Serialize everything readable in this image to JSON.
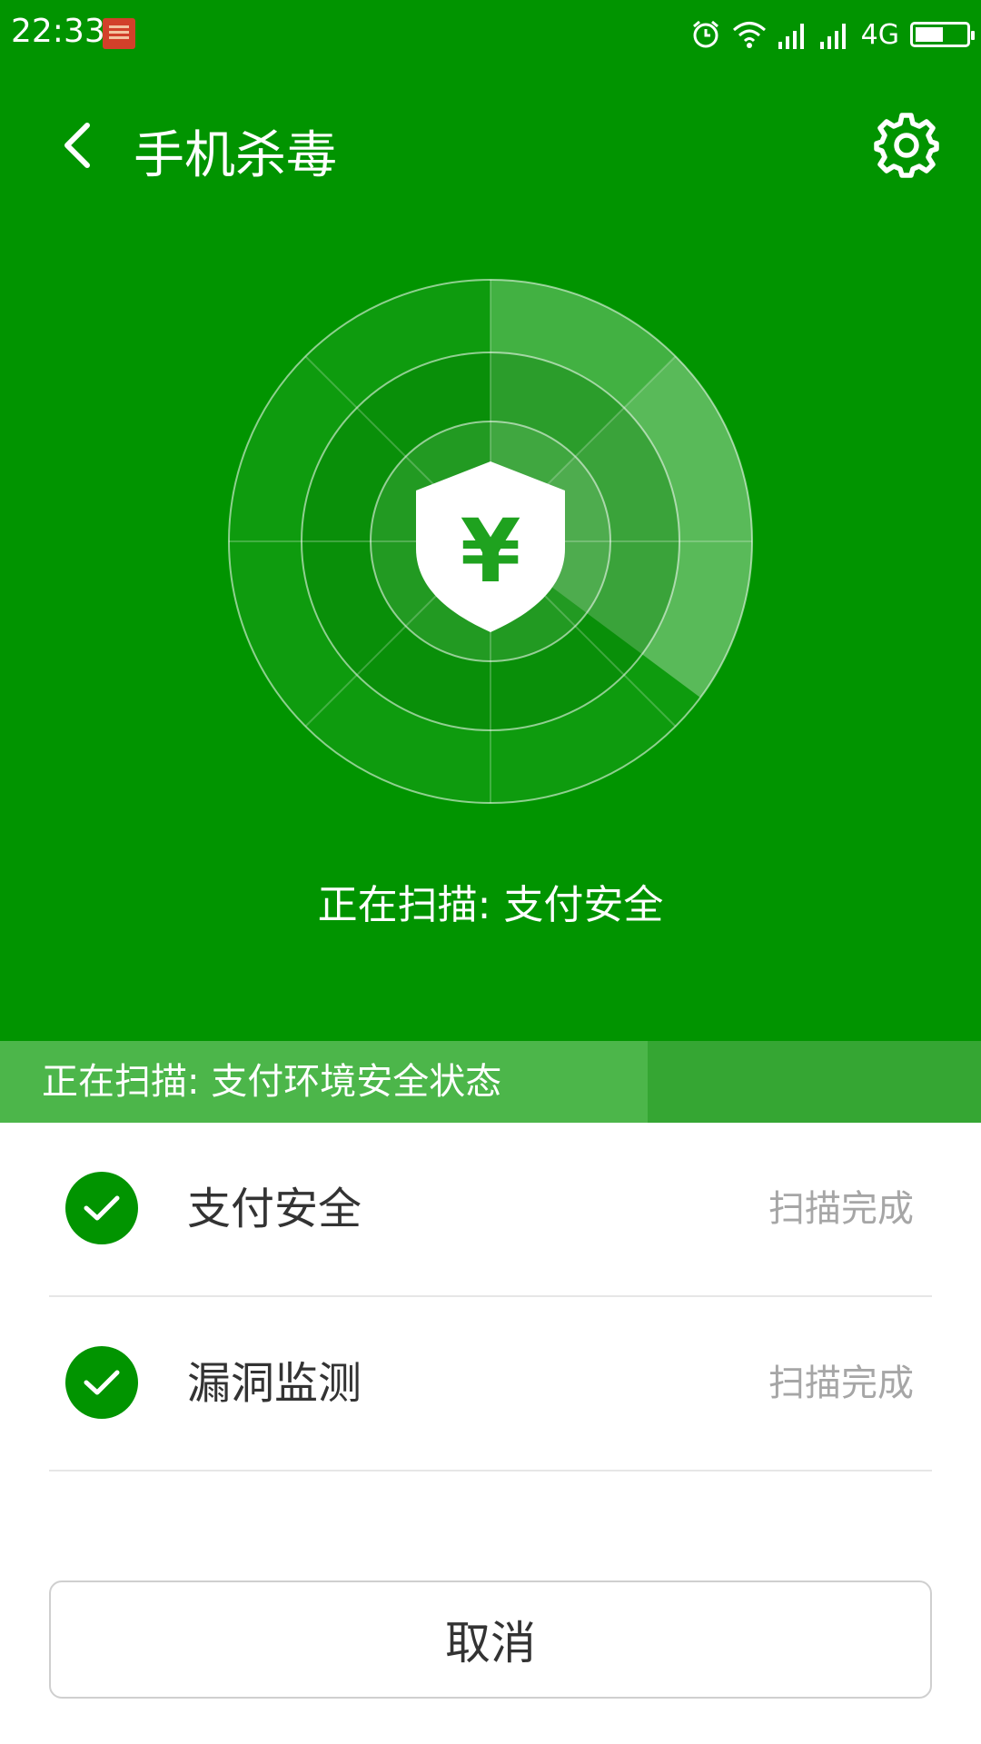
{
  "status_bar": {
    "time": "22:33",
    "network": "4G",
    "battery_level": 0.55,
    "icons": [
      "notification-app-icon",
      "alarm-icon",
      "wifi-icon",
      "signal-icon",
      "signal-icon",
      "battery-icon"
    ]
  },
  "header": {
    "title": "手机杀毒",
    "back_icon": "chevron-left-icon",
    "settings_icon": "gear-icon"
  },
  "radar": {
    "center_icon": "shield-yuan-icon",
    "symbol": "¥"
  },
  "scan_status": "正在扫描: 支付安全",
  "progress": {
    "text": "正在扫描: 支付环境安全状态",
    "value": 0.66
  },
  "scan_items": [
    {
      "label": "支付安全",
      "status": "扫描完成",
      "icon": "check-circle-icon"
    },
    {
      "label": "漏洞监测",
      "status": "扫描完成",
      "icon": "check-circle-icon"
    }
  ],
  "cancel_label": "取消",
  "colors": {
    "primary_green": "#019400",
    "progress_bg": "#35a633",
    "progress_fill": "#4cb64a",
    "muted_text": "#a6a6a6",
    "row_text": "#333333"
  }
}
